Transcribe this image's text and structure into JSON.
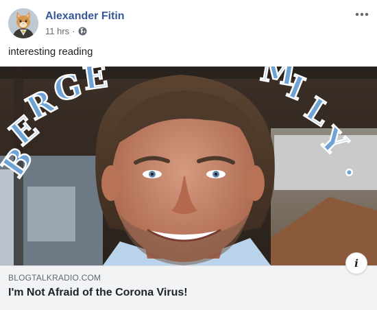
{
  "post": {
    "author": "Alexander Fitin",
    "timestamp": "11 hrs",
    "separator": "·",
    "privacy_icon": "globe-icon",
    "more_icon": "more-options-icon",
    "text": "interesting reading"
  },
  "link_preview": {
    "domain": "BLOGTALKRADIO.COM",
    "title": "I'm Not Afraid of the Corona Virus!",
    "info_label": "i"
  },
  "colors": {
    "author_link": "#365899",
    "meta_gray": "#606770",
    "link_box_bg": "#f2f3f5"
  }
}
